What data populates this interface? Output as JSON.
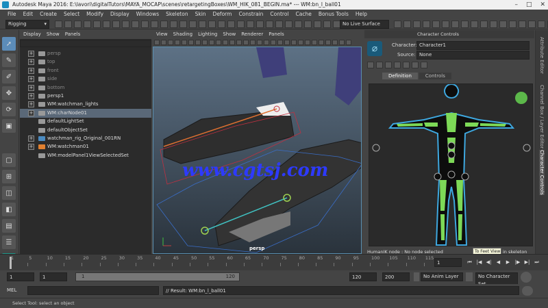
{
  "window": {
    "title": "Autodesk Maya 2016: E:\\lavori\\digitalTutors\\MAYA_MOCAP\\scenes\\retargetingBoxes\\WM_HIK_081_BEGIN.ma*   ---   WM:bn_l_ball01",
    "minimize": "–",
    "maximize": "□",
    "close": "✕"
  },
  "menubar": [
    "File",
    "Edit",
    "Create",
    "Select",
    "Modify",
    "Display",
    "Windows",
    "Skeleton",
    "Skin",
    "Deform",
    "Constrain",
    "Control",
    "Cache",
    "Bonus Tools",
    "Help"
  ],
  "statusline": {
    "menuset": "Rigging",
    "live_surface": "No Live Surface"
  },
  "outliner": {
    "menu": [
      "Display",
      "Show",
      "Panels"
    ],
    "items": [
      {
        "label": "persp",
        "dim": true,
        "expander": "+"
      },
      {
        "label": "top",
        "dim": true,
        "expander": "+"
      },
      {
        "label": "front",
        "dim": true,
        "expander": "+"
      },
      {
        "label": "side",
        "dim": true,
        "expander": "+"
      },
      {
        "label": "bottom",
        "dim": true,
        "expander": "+"
      },
      {
        "label": "persp1",
        "dim": false,
        "expander": "+"
      },
      {
        "label": "WM:watchman_lights",
        "dim": false,
        "expander": "+"
      },
      {
        "label": "WM:charNode01",
        "dim": false,
        "expander": "+",
        "selected": true
      },
      {
        "label": "defaultLightSet",
        "dim": false,
        "expander": ""
      },
      {
        "label": "defaultObjectSet",
        "dim": false,
        "expander": ""
      },
      {
        "label": "watchman_rig_Original_001RN",
        "dim": false,
        "expander": "+"
      },
      {
        "label": "WM:watchman01",
        "dim": false,
        "expander": "+"
      },
      {
        "label": "WM:modelPanel1ViewSelectedSet",
        "dim": false,
        "expander": ""
      }
    ]
  },
  "viewport": {
    "menu": [
      "View",
      "Shading",
      "Lighting",
      "Show",
      "Renderer",
      "Panels"
    ],
    "camera_label": "persp",
    "watermark": "www.cgtsj.com"
  },
  "character_controls": {
    "title": "Character Controls",
    "character_label": "Character:",
    "character_value": "Character1",
    "source_label": "Source:",
    "source_value": "None",
    "tabs": [
      "Definition",
      "Controls"
    ],
    "active_tab": "Definition",
    "status_text": "HumanIK node : No node selected",
    "tooltip": "To Feet View",
    "tooltip_tail": "in skeleton",
    "colors": {
      "body_outline": "#3ea8e0",
      "bone_green": "#7dd957",
      "status_dot": "#5cb84a"
    }
  },
  "right_tabs": [
    "Attribute Editor",
    "Channel Box / Layer Editor",
    "Character Controls"
  ],
  "timeline": {
    "ticks": [
      "1",
      "5",
      "10",
      "15",
      "20",
      "25",
      "30",
      "35",
      "40",
      "45",
      "50",
      "55",
      "60",
      "65",
      "70",
      "75",
      "80",
      "85",
      "90",
      "95",
      "100",
      "105",
      "110",
      "115"
    ],
    "current_frame": "1"
  },
  "range": {
    "start": "1",
    "start_inner": "1",
    "slider_start": "1",
    "slider_end": "120",
    "end_inner": "120",
    "end": "200",
    "anim_layer": "No Anim Layer",
    "character_set": "No Character Set"
  },
  "cmdline": {
    "label": "MEL",
    "result": "// Result: WM:bn_l_ball01"
  },
  "helpline": "Select Tool: select an object"
}
